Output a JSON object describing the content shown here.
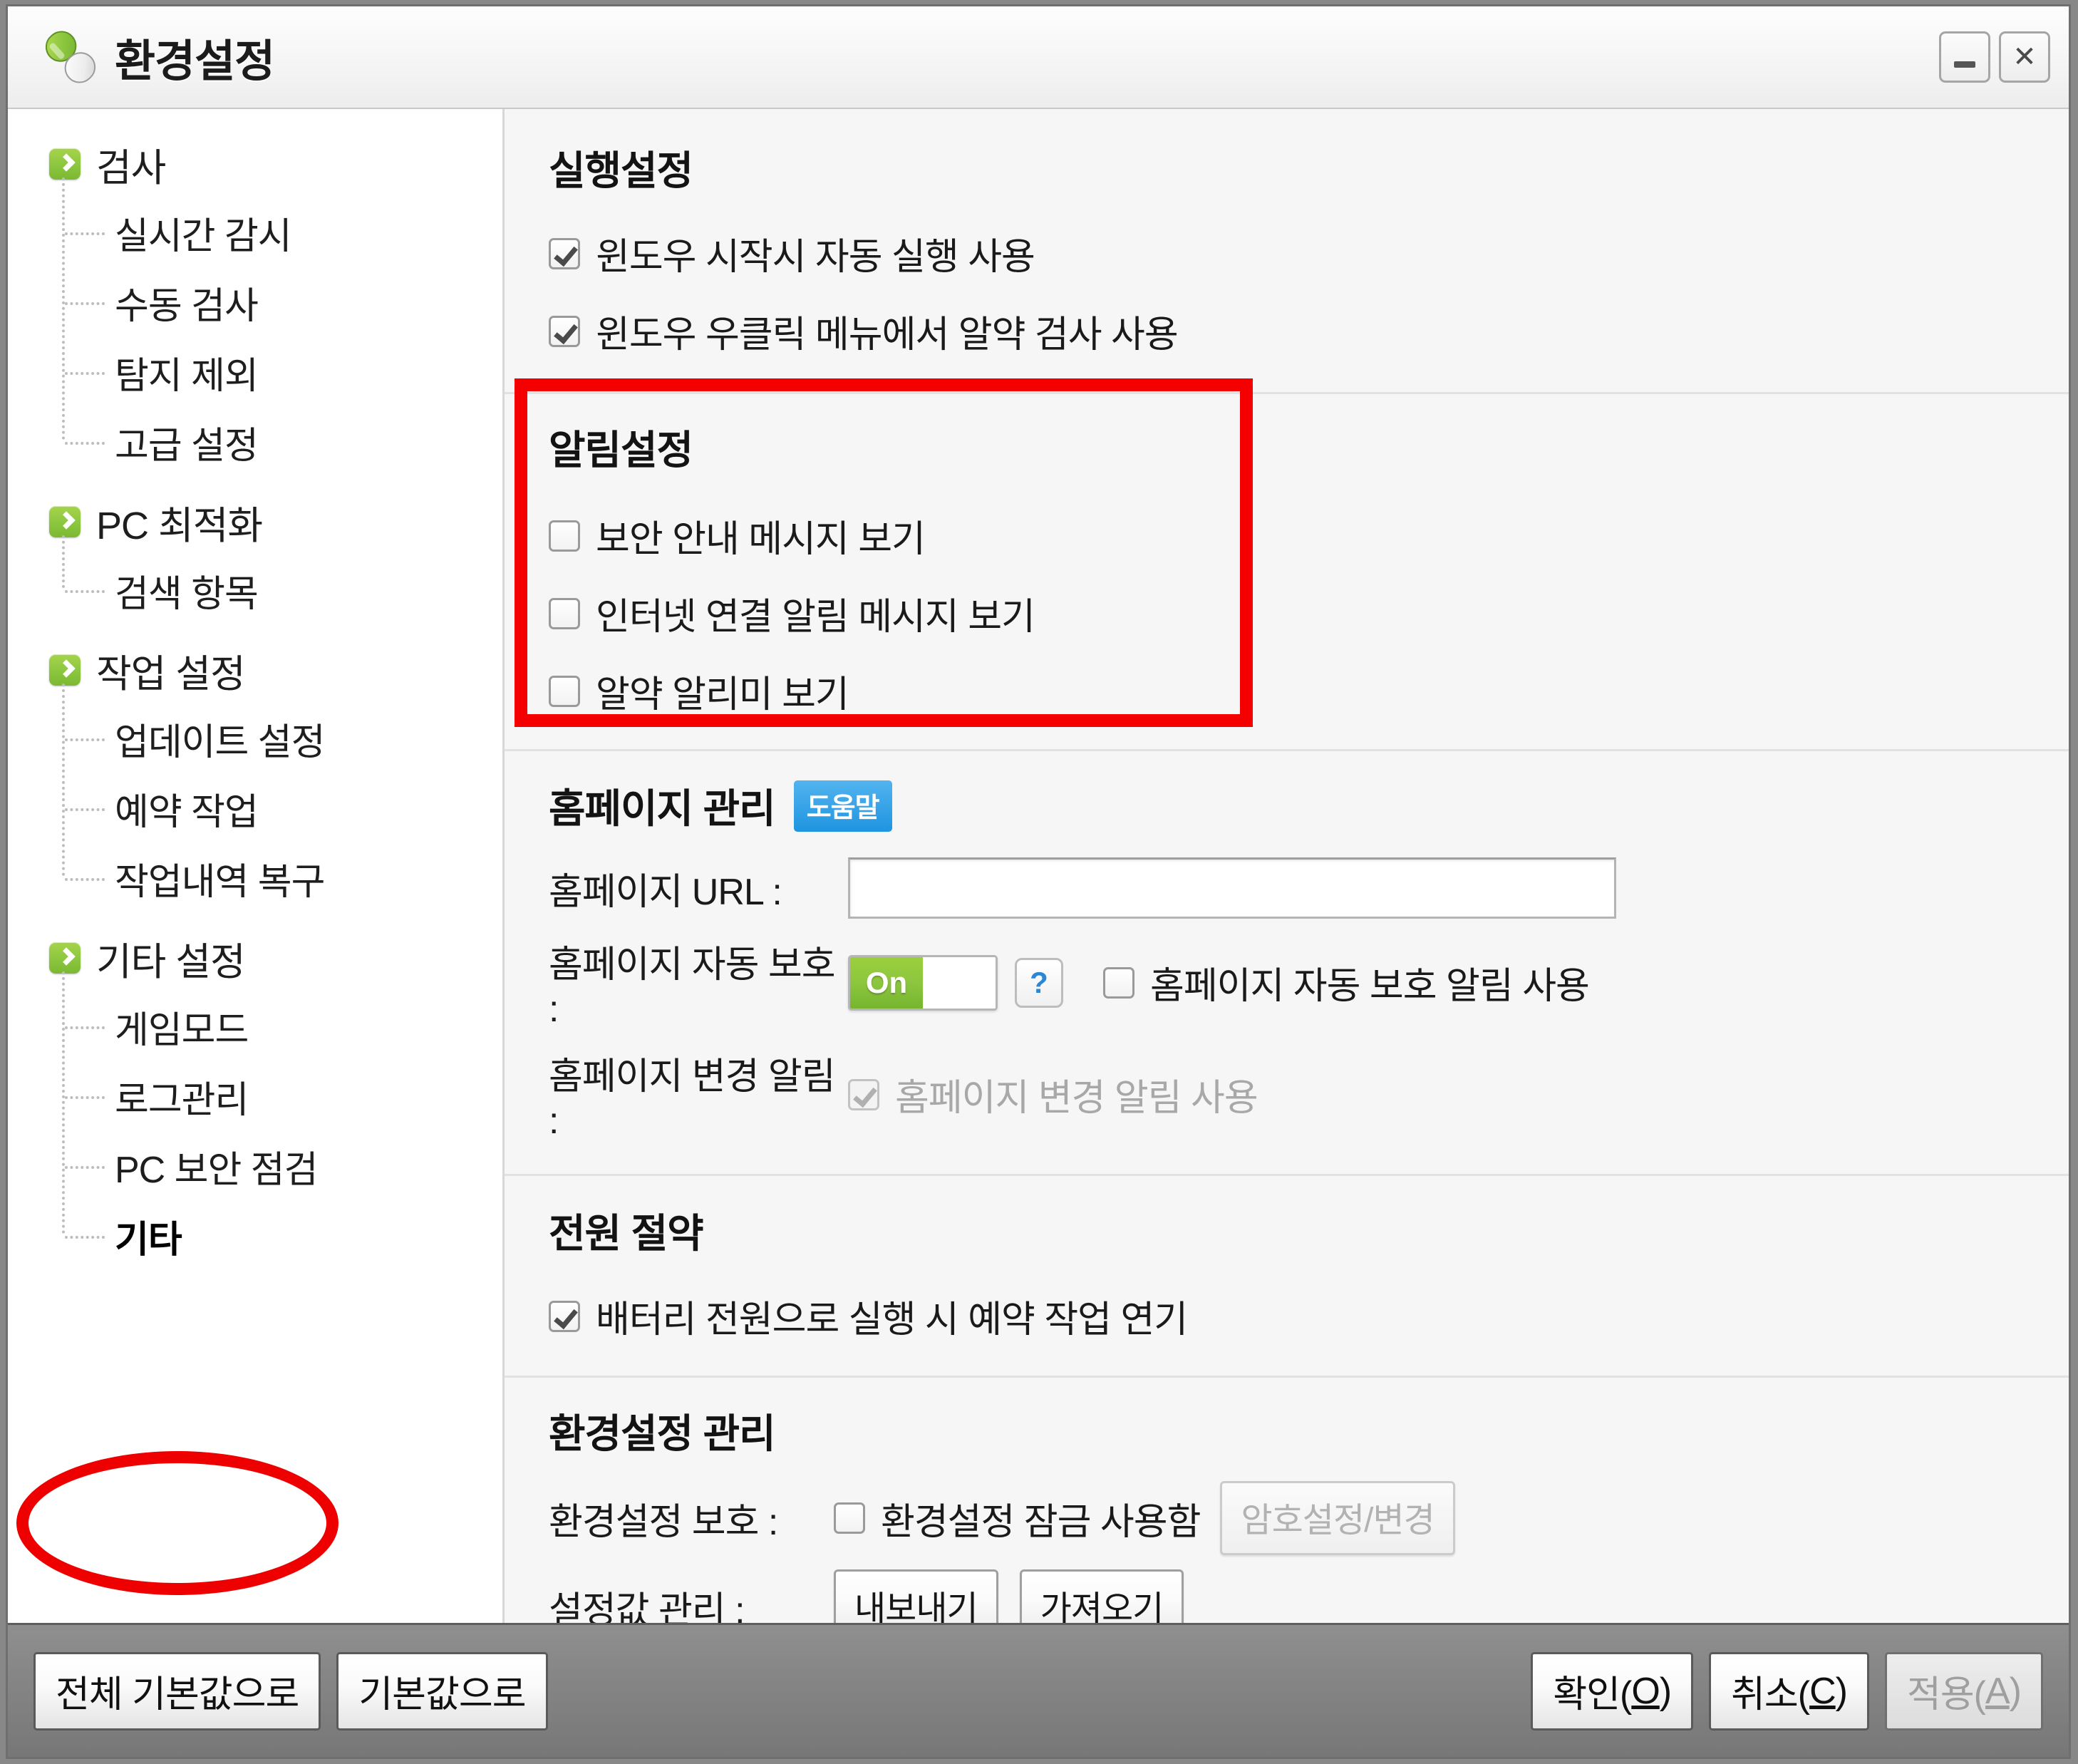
{
  "window": {
    "title": "환경설정",
    "icon": "pill-capsule-icon",
    "minimize_label": "─",
    "close_label": "✕",
    "accent_green": "#8cc63f",
    "annotation_red": "#f40000",
    "help_badge_blue": "#1f94e0"
  },
  "sidebar": {
    "groups": [
      {
        "label": "검사",
        "icon": "green-arrow-icon",
        "children": [
          {
            "label": "실시간 감시",
            "selected": false
          },
          {
            "label": "수동 검사",
            "selected": false
          },
          {
            "label": "탐지 제외",
            "selected": false
          },
          {
            "label": "고급 설정",
            "selected": false
          }
        ]
      },
      {
        "label": "PC 최적화",
        "icon": "green-arrow-icon",
        "children": [
          {
            "label": "검색 항목",
            "selected": false
          }
        ]
      },
      {
        "label": "작업 설정",
        "icon": "green-arrow-icon",
        "children": [
          {
            "label": "업데이트 설정",
            "selected": false
          },
          {
            "label": "예약 작업",
            "selected": false
          },
          {
            "label": "작업내역 복구",
            "selected": false
          }
        ]
      },
      {
        "label": "기타 설정",
        "icon": "green-arrow-icon",
        "children": [
          {
            "label": "게임모드",
            "selected": false
          },
          {
            "label": "로그관리",
            "selected": false
          },
          {
            "label": "PC 보안 점검",
            "selected": false
          },
          {
            "label": "기타",
            "selected": true
          }
        ]
      }
    ]
  },
  "main": {
    "run_settings": {
      "title": "실행설정",
      "items": [
        {
          "label": "윈도우 시작시 자동 실행 사용",
          "checked": true,
          "disabled": false
        },
        {
          "label": "윈도우 우클릭 메뉴에서 알약 검사 사용",
          "checked": true,
          "disabled": false
        }
      ]
    },
    "alert_settings": {
      "title": "알림설정",
      "highlighted": true,
      "items": [
        {
          "label": "보안 안내 메시지 보기",
          "checked": false,
          "disabled": false
        },
        {
          "label": "인터넷 연결 알림 메시지 보기",
          "checked": false,
          "disabled": false
        },
        {
          "label": "알약 알리미 보기",
          "checked": false,
          "disabled": false
        }
      ]
    },
    "homepage": {
      "title": "홈페이지 관리",
      "help_badge": "도움말",
      "url_label": "홈페이지 URL :",
      "url_value": "",
      "url_placeholder": "",
      "autoprotect_label": "홈페이지 자동 보호 :",
      "toggle_state": "On",
      "help_icon": "?",
      "autoprotect_alert_label": "홈페이지 자동 보호 알림 사용",
      "autoprotect_alert_checked": false,
      "change_alert_label": "홈페이지 변경 알림 :",
      "change_alert_checkbox_label": "홈페이지 변경 알림 사용",
      "change_alert_checked": true,
      "change_alert_disabled": true
    },
    "power_saving": {
      "title": "전원 절약",
      "items": [
        {
          "label": "배터리 전원으로 실행 시 예약 작업 연기",
          "checked": true,
          "disabled": false
        }
      ]
    },
    "config_manage": {
      "title": "환경설정 관리",
      "protect_label": "환경설정 보호 :",
      "lock_checkbox_label": "환경설정 잠금 사용함",
      "lock_checked": false,
      "password_button": "암호설정/변경",
      "password_button_disabled": true,
      "values_label": "설정값 관리 :",
      "export_button": "내보내기",
      "import_button": "가져오기"
    }
  },
  "footer": {
    "reset_all": "전체 기본값으로",
    "reset": "기본값으로",
    "ok_text": "확인(",
    "ok_mnemonic": "O",
    "ok_tail": ")",
    "cancel_text": "취소(",
    "cancel_mnemonic": "C",
    "cancel_tail": ")",
    "apply_text": "적용(",
    "apply_mnemonic": "A",
    "apply_tail": ")",
    "apply_disabled": true
  }
}
